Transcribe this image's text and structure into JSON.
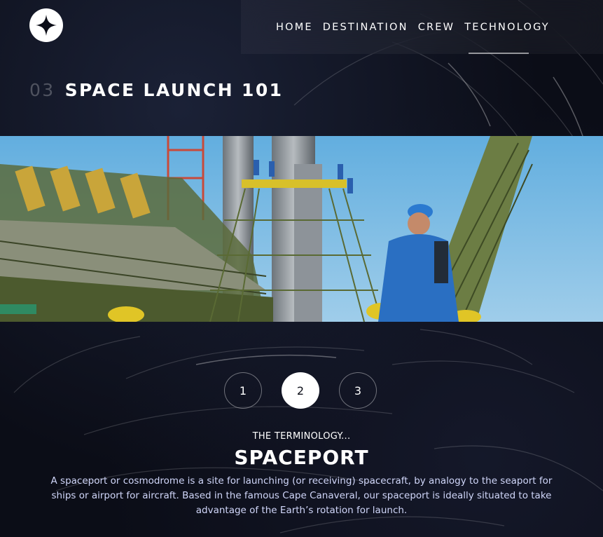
{
  "nav": {
    "items": [
      {
        "label": "HOME"
      },
      {
        "label": "DESTINATION"
      },
      {
        "label": "CREW"
      },
      {
        "label": "TECHNOLOGY",
        "active": true
      }
    ]
  },
  "heading": {
    "number": "03",
    "title": "SPACE LAUNCH 101"
  },
  "pager": {
    "items": [
      "1",
      "2",
      "3"
    ],
    "active": "2"
  },
  "content": {
    "terminology": "THE TERMINOLOGY...",
    "name": "SPACEPORT",
    "description": "A spaceport or cosmodrome is a site for launching (or receiving) spacecraft, by analogy to the seaport for ships or airport for aircraft. Based in the famous Cape Canaveral, our spaceport is ideally situated to take advantage of the Earth’s rotation for launch."
  },
  "colors": {
    "background": "#0b0d17",
    "text": "#ffffff",
    "muted_text": "#d0d6f9"
  },
  "icons": {
    "logo": "four-point-star-icon",
    "photo": "launch-pad-image"
  }
}
